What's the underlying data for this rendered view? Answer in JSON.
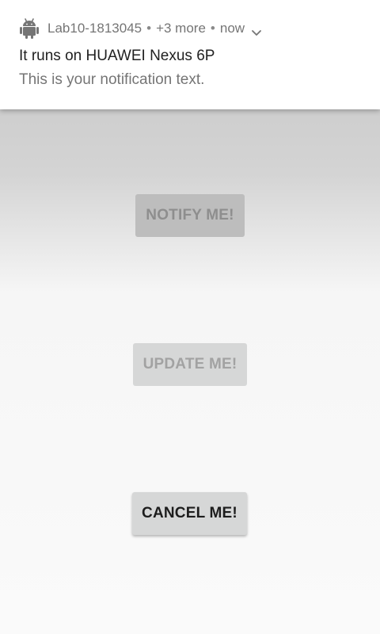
{
  "notification": {
    "app_name": "Lab10-1813045",
    "more_count": "+3 more",
    "time": "now",
    "separator": "•",
    "app_icon": "android-icon",
    "expand_icon": "chevron-down-icon",
    "title": "It runs on HUAWEI Nexus 6P",
    "text": "This is your notification text."
  },
  "buttons": {
    "notify_label": "NOTIFY ME!",
    "update_label": "UPDATE ME!",
    "cancel_label": "CANCEL ME!"
  },
  "colors": {
    "notification_bg": "#ffffff",
    "app_bg": "#fafafa",
    "button_bg": "#d6d7d7",
    "disabled_text": "#a2a2a2",
    "enabled_text": "#1d1d1d"
  }
}
